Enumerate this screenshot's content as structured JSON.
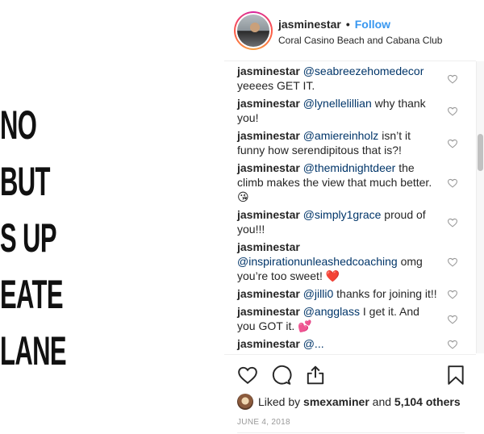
{
  "post_image": {
    "lines": [
      "NO",
      "BUT",
      "S UP",
      "EATE",
      "LANE"
    ]
  },
  "header": {
    "username": "jasminestar",
    "separator": "•",
    "follow_label": "Follow",
    "location": "Coral Casino Beach and Cabana Club"
  },
  "comments": [
    {
      "user": "jasminestar",
      "mention": "@seabreezehomedecor",
      "text": " yeeees GET IT.",
      "emoji": ""
    },
    {
      "user": "jasminestar",
      "mention": "@lynellelillian",
      "text": " why thank you!",
      "emoji": ""
    },
    {
      "user": "jasminestar",
      "mention": "@amiereinholz",
      "text": " isn’t it funny how serendipitous that is?!",
      "emoji": ""
    },
    {
      "user": "jasminestar",
      "mention": "@themidnightdeer",
      "text": " the climb makes the view that much better. ",
      "emoji": "😘"
    },
    {
      "user": "jasminestar",
      "mention": "@simply1grace",
      "text": " proud of you!!!",
      "emoji": ""
    },
    {
      "user": "jasminestar",
      "mention": "@inspirationunleashedcoaching",
      "text": " omg you’re too sweet! ",
      "emoji": "❤️"
    },
    {
      "user": "jasminestar",
      "mention": "@jilli0",
      "text": " thanks for joining it!!",
      "emoji": ""
    },
    {
      "user": "jasminestar",
      "mention": "@angglass",
      "text": " I get it. And you GOT it. ",
      "emoji": "💕"
    },
    {
      "user": "jasminestar",
      "mention": "@...",
      "text": "",
      "emoji": ""
    }
  ],
  "actions": {
    "like_icon": "heart-outline",
    "comment_icon": "speech-bubble",
    "share_icon": "share-arrow",
    "save_icon": "bookmark"
  },
  "likes": {
    "prefix": "Liked by ",
    "liker": "smexaminer",
    "middle": " and ",
    "count": "5,104 others"
  },
  "date": "JUNE 4, 2018",
  "colors": {
    "follow": "#3897f0",
    "mention": "#003569",
    "date": "#999999"
  }
}
